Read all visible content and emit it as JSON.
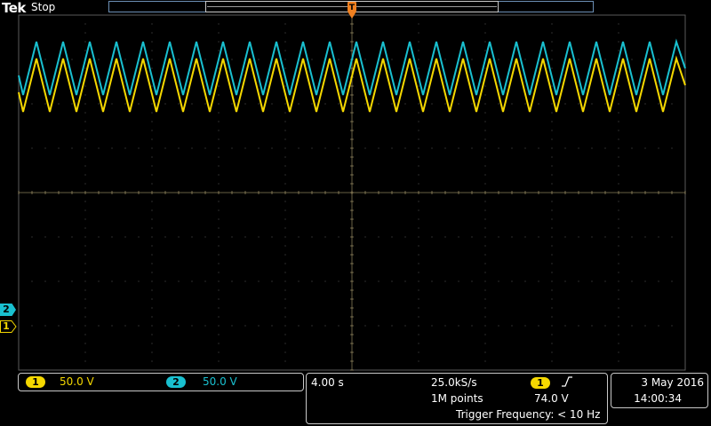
{
  "header": {
    "brand": "Tek",
    "acquisition_status": "Stop",
    "trigger_position_marker": "T"
  },
  "graticule": {
    "horizontal_divisions": 10,
    "vertical_divisions": 8,
    "grid_color": "#5a5a5a",
    "center_line_color": "#b0a070"
  },
  "channels": [
    {
      "id": "ch1",
      "label": "1",
      "scale": "50.0 V",
      "color": "#f5d800"
    },
    {
      "id": "ch2",
      "label": "2",
      "scale": "50.0 V",
      "color": "#19c0d0"
    }
  ],
  "horizontal": {
    "time_per_div": "4.00 s",
    "sample_rate": "25.0kS/s",
    "record_length": "1M points"
  },
  "trigger": {
    "source_label": "1",
    "slope_symbol": "⎍",
    "level": "74.0 V",
    "frequency": "Trigger Frequency: < 10 Hz",
    "color": "#f5d800"
  },
  "datetime": {
    "date": "3 May  2016",
    "time": "14:00:34"
  },
  "waveform": {
    "type": "triangle",
    "cycles_on_screen": 25
  }
}
